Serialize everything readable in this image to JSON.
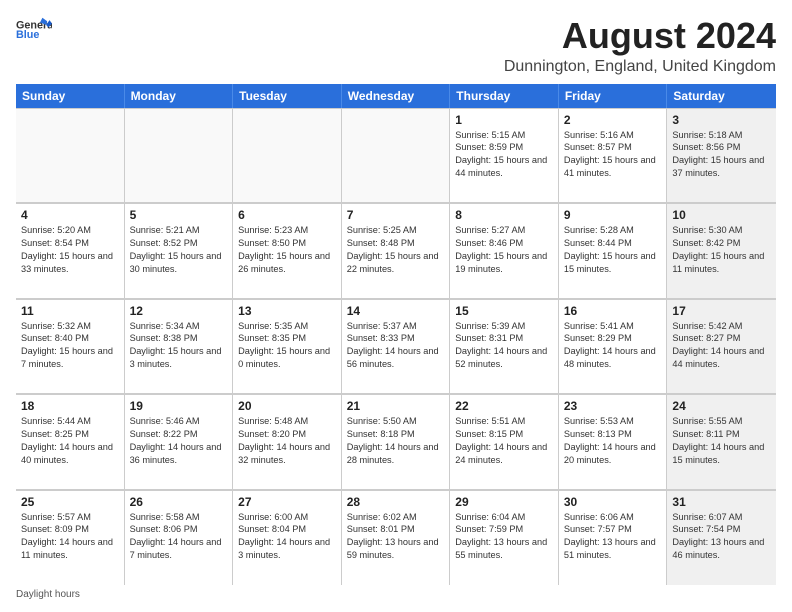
{
  "header": {
    "logo_general": "General",
    "logo_blue": "Blue",
    "month_title": "August 2024",
    "location": "Dunnington, England, United Kingdom"
  },
  "days_of_week": [
    "Sunday",
    "Monday",
    "Tuesday",
    "Wednesday",
    "Thursday",
    "Friday",
    "Saturday"
  ],
  "weeks": [
    [
      {
        "day": "",
        "text": "",
        "empty": true
      },
      {
        "day": "",
        "text": "",
        "empty": true
      },
      {
        "day": "",
        "text": "",
        "empty": true
      },
      {
        "day": "",
        "text": "",
        "empty": true
      },
      {
        "day": "1",
        "text": "Sunrise: 5:15 AM\nSunset: 8:59 PM\nDaylight: 15 hours and 44 minutes.",
        "empty": false
      },
      {
        "day": "2",
        "text": "Sunrise: 5:16 AM\nSunset: 8:57 PM\nDaylight: 15 hours and 41 minutes.",
        "empty": false
      },
      {
        "day": "3",
        "text": "Sunrise: 5:18 AM\nSunset: 8:56 PM\nDaylight: 15 hours and 37 minutes.",
        "empty": false,
        "shaded": true
      }
    ],
    [
      {
        "day": "4",
        "text": "Sunrise: 5:20 AM\nSunset: 8:54 PM\nDaylight: 15 hours and 33 minutes.",
        "empty": false
      },
      {
        "day": "5",
        "text": "Sunrise: 5:21 AM\nSunset: 8:52 PM\nDaylight: 15 hours and 30 minutes.",
        "empty": false
      },
      {
        "day": "6",
        "text": "Sunrise: 5:23 AM\nSunset: 8:50 PM\nDaylight: 15 hours and 26 minutes.",
        "empty": false
      },
      {
        "day": "7",
        "text": "Sunrise: 5:25 AM\nSunset: 8:48 PM\nDaylight: 15 hours and 22 minutes.",
        "empty": false
      },
      {
        "day": "8",
        "text": "Sunrise: 5:27 AM\nSunset: 8:46 PM\nDaylight: 15 hours and 19 minutes.",
        "empty": false
      },
      {
        "day": "9",
        "text": "Sunrise: 5:28 AM\nSunset: 8:44 PM\nDaylight: 15 hours and 15 minutes.",
        "empty": false
      },
      {
        "day": "10",
        "text": "Sunrise: 5:30 AM\nSunset: 8:42 PM\nDaylight: 15 hours and 11 minutes.",
        "empty": false,
        "shaded": true
      }
    ],
    [
      {
        "day": "11",
        "text": "Sunrise: 5:32 AM\nSunset: 8:40 PM\nDaylight: 15 hours and 7 minutes.",
        "empty": false
      },
      {
        "day": "12",
        "text": "Sunrise: 5:34 AM\nSunset: 8:38 PM\nDaylight: 15 hours and 3 minutes.",
        "empty": false
      },
      {
        "day": "13",
        "text": "Sunrise: 5:35 AM\nSunset: 8:35 PM\nDaylight: 15 hours and 0 minutes.",
        "empty": false
      },
      {
        "day": "14",
        "text": "Sunrise: 5:37 AM\nSunset: 8:33 PM\nDaylight: 14 hours and 56 minutes.",
        "empty": false
      },
      {
        "day": "15",
        "text": "Sunrise: 5:39 AM\nSunset: 8:31 PM\nDaylight: 14 hours and 52 minutes.",
        "empty": false
      },
      {
        "day": "16",
        "text": "Sunrise: 5:41 AM\nSunset: 8:29 PM\nDaylight: 14 hours and 48 minutes.",
        "empty": false
      },
      {
        "day": "17",
        "text": "Sunrise: 5:42 AM\nSunset: 8:27 PM\nDaylight: 14 hours and 44 minutes.",
        "empty": false,
        "shaded": true
      }
    ],
    [
      {
        "day": "18",
        "text": "Sunrise: 5:44 AM\nSunset: 8:25 PM\nDaylight: 14 hours and 40 minutes.",
        "empty": false
      },
      {
        "day": "19",
        "text": "Sunrise: 5:46 AM\nSunset: 8:22 PM\nDaylight: 14 hours and 36 minutes.",
        "empty": false
      },
      {
        "day": "20",
        "text": "Sunrise: 5:48 AM\nSunset: 8:20 PM\nDaylight: 14 hours and 32 minutes.",
        "empty": false
      },
      {
        "day": "21",
        "text": "Sunrise: 5:50 AM\nSunset: 8:18 PM\nDaylight: 14 hours and 28 minutes.",
        "empty": false
      },
      {
        "day": "22",
        "text": "Sunrise: 5:51 AM\nSunset: 8:15 PM\nDaylight: 14 hours and 24 minutes.",
        "empty": false
      },
      {
        "day": "23",
        "text": "Sunrise: 5:53 AM\nSunset: 8:13 PM\nDaylight: 14 hours and 20 minutes.",
        "empty": false
      },
      {
        "day": "24",
        "text": "Sunrise: 5:55 AM\nSunset: 8:11 PM\nDaylight: 14 hours and 15 minutes.",
        "empty": false,
        "shaded": true
      }
    ],
    [
      {
        "day": "25",
        "text": "Sunrise: 5:57 AM\nSunset: 8:09 PM\nDaylight: 14 hours and 11 minutes.",
        "empty": false
      },
      {
        "day": "26",
        "text": "Sunrise: 5:58 AM\nSunset: 8:06 PM\nDaylight: 14 hours and 7 minutes.",
        "empty": false
      },
      {
        "day": "27",
        "text": "Sunrise: 6:00 AM\nSunset: 8:04 PM\nDaylight: 14 hours and 3 minutes.",
        "empty": false
      },
      {
        "day": "28",
        "text": "Sunrise: 6:02 AM\nSunset: 8:01 PM\nDaylight: 13 hours and 59 minutes.",
        "empty": false
      },
      {
        "day": "29",
        "text": "Sunrise: 6:04 AM\nSunset: 7:59 PM\nDaylight: 13 hours and 55 minutes.",
        "empty": false
      },
      {
        "day": "30",
        "text": "Sunrise: 6:06 AM\nSunset: 7:57 PM\nDaylight: 13 hours and 51 minutes.",
        "empty": false
      },
      {
        "day": "31",
        "text": "Sunrise: 6:07 AM\nSunset: 7:54 PM\nDaylight: 13 hours and 46 minutes.",
        "empty": false,
        "shaded": true
      }
    ]
  ],
  "footer": {
    "daylight_hours_label": "Daylight hours"
  }
}
